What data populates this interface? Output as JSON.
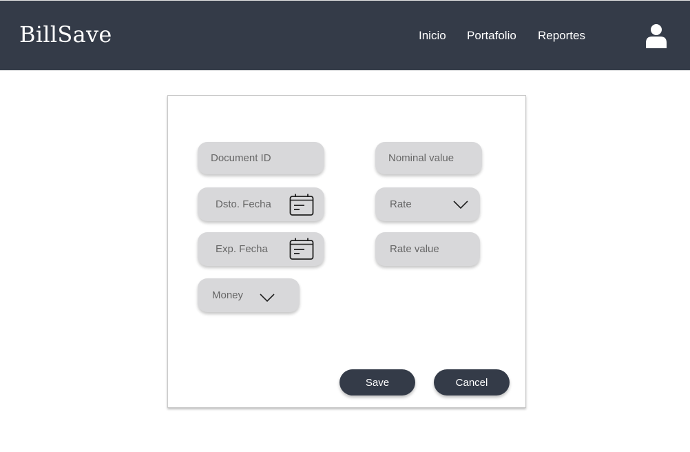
{
  "header": {
    "brand": "BillSave",
    "nav": {
      "inicio": "Inicio",
      "portafolio": "Portafolio",
      "reportes": "Reportes"
    },
    "user_icon": "user-icon",
    "background_color": "#343b48"
  },
  "form": {
    "document_id": {
      "placeholder": "Document ID",
      "value": ""
    },
    "nominal_value": {
      "placeholder": "Nominal value",
      "value": ""
    },
    "dsto_fecha": {
      "label": "Dsto. Fecha",
      "icon": "calendar-icon"
    },
    "exp_fecha": {
      "label": "Exp. Fecha",
      "icon": "calendar-icon"
    },
    "rate": {
      "label": "Rate",
      "icon": "chevron-down-icon"
    },
    "rate_value": {
      "placeholder": "Rate value",
      "value": ""
    },
    "money": {
      "label": "Money",
      "icon": "chevron-down-icon"
    },
    "save_label": "Save",
    "cancel_label": "Cancel",
    "field_color": "#d8d8da"
  }
}
